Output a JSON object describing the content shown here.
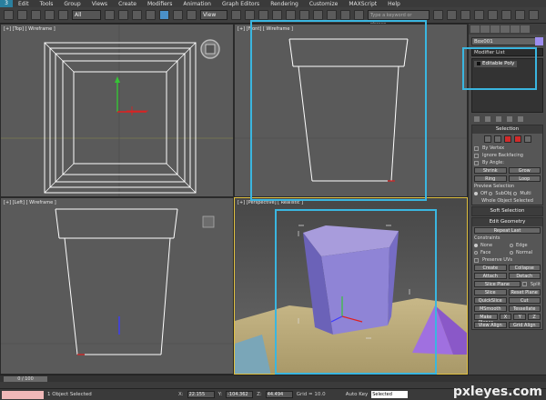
{
  "menubar": {
    "app_icon": "3",
    "items": [
      "Edit",
      "Tools",
      "Group",
      "Views",
      "Create",
      "Modifiers",
      "Animation",
      "Graph Editors",
      "Rendering",
      "Customize",
      "MAXScript",
      "Help"
    ]
  },
  "toolbar": {
    "filter_value": "All",
    "view_value": "View",
    "search_placeholder": "Type a keyword or phrase"
  },
  "viewports": [
    {
      "label": "[+] [Top] [ Wireframe ]"
    },
    {
      "label": "[+] [Front] [ Wireframe ]"
    },
    {
      "label": "[+] [Left] [ Wireframe ]"
    },
    {
      "label": "[+] [Perspective] [ Realistic ]"
    }
  ],
  "panel": {
    "object_name": "Box001",
    "object_color": "#9d8df0",
    "modifier_list": "Modifier List",
    "stack_item": "Editable Poly",
    "selection_title": "Selection",
    "by_vertex": "By Vertex",
    "ignore_backfacing": "Ignore Backfacing",
    "by_angle": "By Angle:",
    "shrink": "Shrink",
    "grow": "Grow",
    "ring": "Ring",
    "loop": "Loop",
    "preview_selection": "Preview Selection",
    "off": "Off",
    "subobj": "SubObj",
    "multi": "Multi",
    "whole_object_selected": "Whole Object Selected",
    "soft_selection": "Soft Selection",
    "edit_geometry": "Edit Geometry",
    "repeat_last": "Repeat Last",
    "constraints": "Constraints",
    "none": "None",
    "edge": "Edge",
    "face": "Face",
    "normal": "Normal",
    "preserve_uvs": "Preserve UVs",
    "create": "Create",
    "collapse": "Collapse",
    "attach": "Attach",
    "detach": "Detach",
    "slice_plane": "Slice Plane",
    "split": "Split",
    "slice": "Slice",
    "reset_plane": "Reset Plane",
    "quickslice": "QuickSlice",
    "cut": "Cut",
    "msmooth": "MSmooth",
    "tessellate": "Tessellate",
    "make_planar": "Make Planar",
    "x": "X",
    "y": "Y",
    "z": "Z",
    "view_align": "View Align",
    "grid_align": "Grid Align"
  },
  "timeline": {
    "frame": "0 / 100"
  },
  "status": {
    "selection": "1 Object Selected",
    "x_label": "X:",
    "x_value": "22.155",
    "y_label": "Y:",
    "y_value": "-104.362",
    "z_label": "Z:",
    "z_value": "44.494",
    "grid": "Grid = 10.0",
    "auto_key": "Auto Key",
    "selected": "Selected"
  },
  "watermark": "pxleyes.com"
}
